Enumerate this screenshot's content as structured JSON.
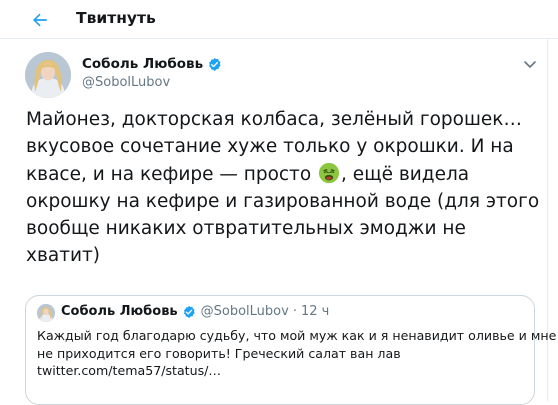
{
  "header": {
    "title": "Твитнуть"
  },
  "tweet": {
    "author_name": "Соболь Любовь",
    "author_handle": "@SobolLubov",
    "text_lines": [
      "Майонез, докторская колбаса, зелёный горошек…",
      "вкусовое сочетание хуже только у окрошки. И на",
      "квасе, и на кефире — просто",
      ", ещё видела",
      "окрошку на кефире и газированной воде (для этого",
      "вообще никаких отвратительных эмоджи не",
      "хватит)"
    ],
    "emoji": "nauseated-face-emoji"
  },
  "quote": {
    "author_name": "Соболь Любовь",
    "author_handle": "@SobolLubov",
    "separator": "·",
    "time": "12 ч",
    "text_lines": [
      "Каждый год благодарю судьбу, что мой муж как и я ненавидит оливье и мне",
      "не приходится его говорить! Греческий салат ван лав",
      "twitter.com/tema57/status/…"
    ]
  },
  "colors": {
    "accent": "#1da1f2",
    "text": "#14171a",
    "secondary": "#657786",
    "border": "#ccd6dd"
  }
}
